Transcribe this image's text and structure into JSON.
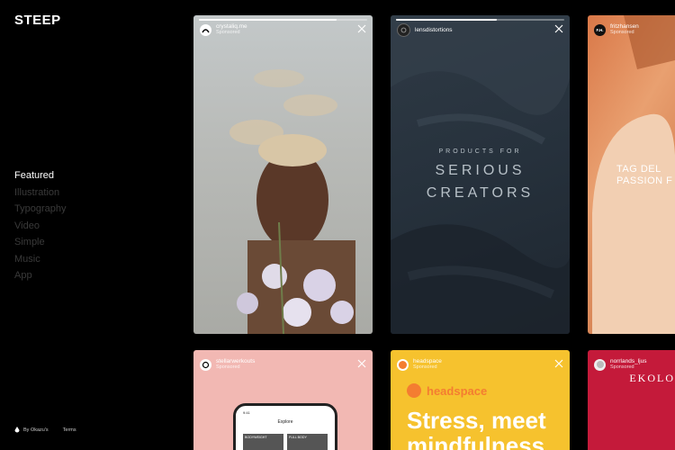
{
  "app": {
    "name": "STEEP"
  },
  "nav": {
    "items": [
      {
        "label": "Featured",
        "active": true
      },
      {
        "label": "Illustration",
        "active": false
      },
      {
        "label": "Typography",
        "active": false
      },
      {
        "label": "Video",
        "active": false
      },
      {
        "label": "Simple",
        "active": false
      },
      {
        "label": "Music",
        "active": false
      },
      {
        "label": "App",
        "active": false
      }
    ]
  },
  "footer": {
    "by": "By Okazu's",
    "terms": "Terms"
  },
  "cards": [
    {
      "user": "crystaliq.me",
      "sponsored": "Sponsored",
      "progress": 0.82
    },
    {
      "user": "lensdistortions",
      "sponsored": "Sponsored",
      "progress": 0.6,
      "small_text": "PRODUCTS FOR",
      "line1": "SERIOUS",
      "line2": "CREATORS"
    },
    {
      "user": "fritzhansen",
      "sponsored": "Sponsored",
      "avatar_text": "F.H.",
      "tag1": "TAG DEL",
      "tag2": "PASSION F"
    },
    {
      "user": "stellarwerkouts",
      "sponsored": "Sponsored",
      "phone": {
        "time": "9:41",
        "title": "Explore",
        "tiles": [
          "BODYWEIGHT",
          "FULL BODY"
        ]
      }
    },
    {
      "user": "headspace",
      "sponsored": "Sponsored",
      "brand": "headspace",
      "headline": "Stress, meet",
      "headline2": "mindfulness"
    },
    {
      "user": "norrlands_ljus",
      "sponsored": "Sponsored",
      "brand": "EKOLO"
    }
  ],
  "colors": {
    "background": "#000000",
    "headspace_orange": "#f47d31",
    "headspace_yellow": "#f6c22e",
    "norrlands_red": "#c41a3a"
  }
}
